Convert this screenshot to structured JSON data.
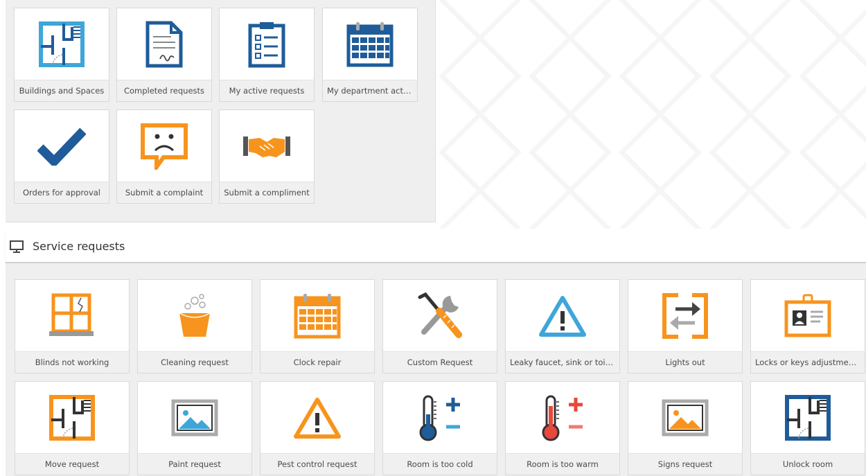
{
  "quick_actions": [
    {
      "label": "Buildings and Spaces",
      "icon": "floorplan-icon"
    },
    {
      "label": "Completed requests",
      "icon": "signed-document-icon"
    },
    {
      "label": "My active requests",
      "icon": "clipboard-checklist-icon"
    },
    {
      "label": "My department activ...",
      "icon": "calendar-icon"
    },
    {
      "label": "Orders for approval",
      "icon": "checkmark-icon"
    },
    {
      "label": "Submit a complaint",
      "icon": "sad-face-bubble-icon"
    },
    {
      "label": "Submit a compliment",
      "icon": "handshake-icon"
    }
  ],
  "service_section": {
    "title": "Service requests",
    "icon": "monitor-icon"
  },
  "service_requests": [
    {
      "label": "Blinds not working",
      "icon": "broken-window-icon"
    },
    {
      "label": "Cleaning request",
      "icon": "bucket-icon"
    },
    {
      "label": "Clock repair",
      "icon": "calendar-icon"
    },
    {
      "label": "Custom Request",
      "icon": "tools-icon"
    },
    {
      "label": "Leaky faucet, sink or toilet",
      "icon": "warning-icon"
    },
    {
      "label": "Lights out",
      "icon": "swap-arrows-icon"
    },
    {
      "label": "Locks or keys adjustments",
      "icon": "id-badge-icon"
    },
    {
      "label": "Move request",
      "icon": "floorplan-icon"
    },
    {
      "label": "Paint request",
      "icon": "picture-icon"
    },
    {
      "label": "Pest control request",
      "icon": "warning-icon"
    },
    {
      "label": "Room is too cold",
      "icon": "thermometer-cold-icon"
    },
    {
      "label": "Room is too warm",
      "icon": "thermometer-warm-icon"
    },
    {
      "label": "Signs request",
      "icon": "picture-icon"
    },
    {
      "label": "Unlock room",
      "icon": "floorplan-icon"
    }
  ],
  "colors": {
    "blue": "#1f5c99",
    "light_blue": "#3ea6d9",
    "orange": "#f7941d",
    "red": "#e8473b",
    "gray": "#888888"
  }
}
